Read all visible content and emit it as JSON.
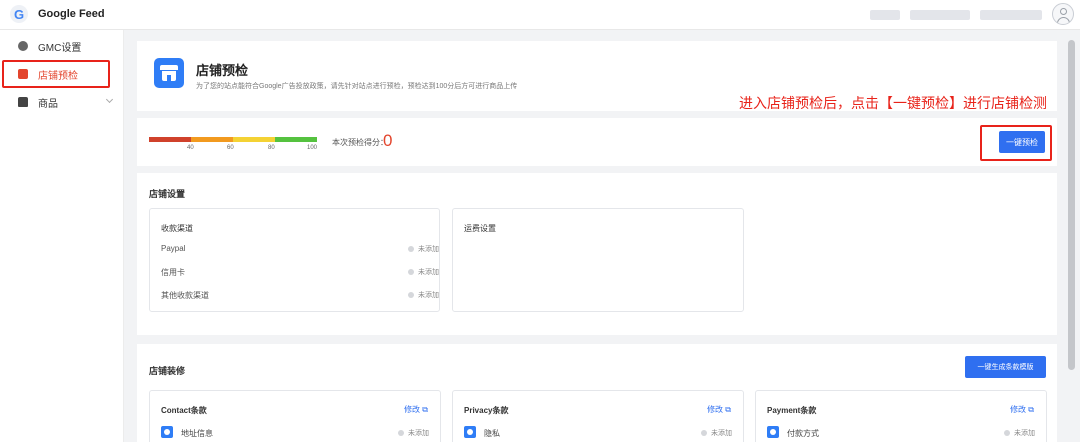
{
  "app": {
    "logo_letter": "G",
    "title": "Google Feed"
  },
  "sidebar": {
    "items": [
      {
        "label": "GMC设置",
        "icon": "settings-circle-icon"
      },
      {
        "label": "店铺预检",
        "icon": "store-icon",
        "active": true
      },
      {
        "label": "商品",
        "icon": "shopping-bag-icon"
      }
    ]
  },
  "header": {
    "title": "店铺预检",
    "subtitle": "为了您的站点能符合Google广告投放政策，请先针对站点进行预检，预检达到100分后方可进行商品上传",
    "annotation": "进入店铺预检后，点击【一键预检】进行店铺检测"
  },
  "score": {
    "ticks": [
      "40",
      "60",
      "80",
      "100"
    ],
    "label": "本次预检得分：",
    "value": "0",
    "button_label": "一键预检",
    "colors": [
      "#d0412b",
      "#f29a1f",
      "#f4d234",
      "#55c23f"
    ]
  },
  "shop_settings": {
    "title": "店铺设置",
    "payment": {
      "title": "收款渠道",
      "rows": [
        {
          "label": "Paypal",
          "status": "未添加"
        },
        {
          "label": "信用卡",
          "status": "未添加"
        },
        {
          "label": "其他收款渠道",
          "status": "未添加"
        }
      ]
    },
    "shipping": {
      "title": "运费设置"
    }
  },
  "decoration": {
    "title": "店铺装修",
    "generate_button": "一键生成条款模版",
    "terms": [
      {
        "title": "Contact条款",
        "edit": "修改",
        "item": "地址信息",
        "status": "未添加"
      },
      {
        "title": "Privacy条款",
        "edit": "修改",
        "item": "隐私",
        "status": "未添加"
      },
      {
        "title": "Payment条款",
        "edit": "修改",
        "item": "付款方式",
        "status": "未添加"
      }
    ]
  }
}
